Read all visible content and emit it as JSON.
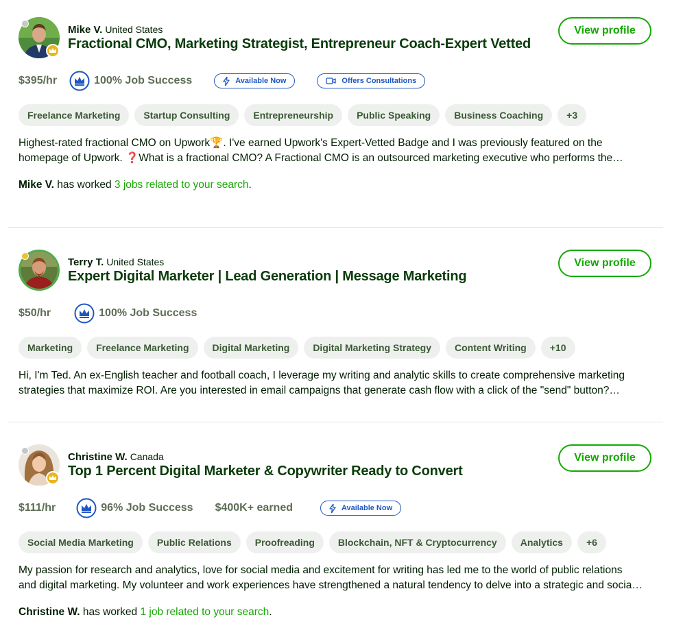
{
  "freelancers": [
    {
      "name": "Mike V.",
      "country": "United States",
      "title": "Fractional CMO, Marketing Strategist, Entrepreneur Coach-Expert Vetted",
      "view_label": "View profile",
      "rate": "$395/hr",
      "job_success": "100% Job Success",
      "badges": [
        "Available Now",
        "Offers Consultations"
      ],
      "tags": [
        "Freelance Marketing",
        "Startup Consulting",
        "Entrepreneurship",
        "Public Speaking",
        "Business Coaching",
        "+3"
      ],
      "desc_line1": "Highest-rated fractional CMO on Upwork🏆. I've earned Upwork's Expert-Vetted Badge and I was previously featured on the",
      "desc_line2": "homepage of Upwork.  ❓What is a fractional CMO? A Fractional CMO is an outsourced marketing executive who performs the…",
      "worked_name": "Mike V.",
      "worked_text": " has worked ",
      "worked_link": "3 jobs related to your search",
      "worked_end": "."
    },
    {
      "name": "Terry T.",
      "country": "United States",
      "title": "Expert Digital Marketer | Lead Generation | Message Marketing",
      "view_label": "View profile",
      "rate": "$50/hr",
      "job_success": "100% Job Success",
      "tags": [
        "Marketing",
        "Freelance Marketing",
        "Digital Marketing",
        "Digital Marketing Strategy",
        "Content Writing",
        "+10"
      ],
      "desc_line1": "Hi, I'm Ted. An ex-English teacher and football coach, I leverage my writing and analytic skills to create comprehensive marketing",
      "desc_line2": "strategies that maximize ROI. Are you interested in email campaigns that generate cash flow with a click of the \"send\" button?…"
    },
    {
      "name": "Christine W.",
      "country": "Canada",
      "title": "Top 1 Percent Digital Marketer & Copywriter Ready to Convert",
      "view_label": "View profile",
      "rate": "$111/hr",
      "job_success": "96% Job Success",
      "earned": "$400K+ earned",
      "badges": [
        "Available Now"
      ],
      "tags": [
        "Social Media Marketing",
        "Public Relations",
        "Proofreading",
        "Blockchain, NFT & Cryptocurrency",
        "Analytics",
        "+6"
      ],
      "desc_line1": "My passion for research and analytics, love for social media and excitement for writing has led me to the world of public relations",
      "desc_line2": "and digital marketing. My volunteer and work experiences have strengthened a natural tendency to delve into a strategic and socia…",
      "worked_name": "Christine W.",
      "worked_text": " has worked ",
      "worked_link": "1 job related to your search",
      "worked_end": "."
    }
  ],
  "colors": {
    "accent_green": "#14a800",
    "badge_blue": "#1f57c3",
    "tag_bg": "#eef0ee",
    "muted_text": "#5e6d55"
  },
  "icons": [
    "crown-icon",
    "lightning-icon",
    "video-camera-icon",
    "top-rated-badge-icon",
    "status-dot-icon"
  ]
}
